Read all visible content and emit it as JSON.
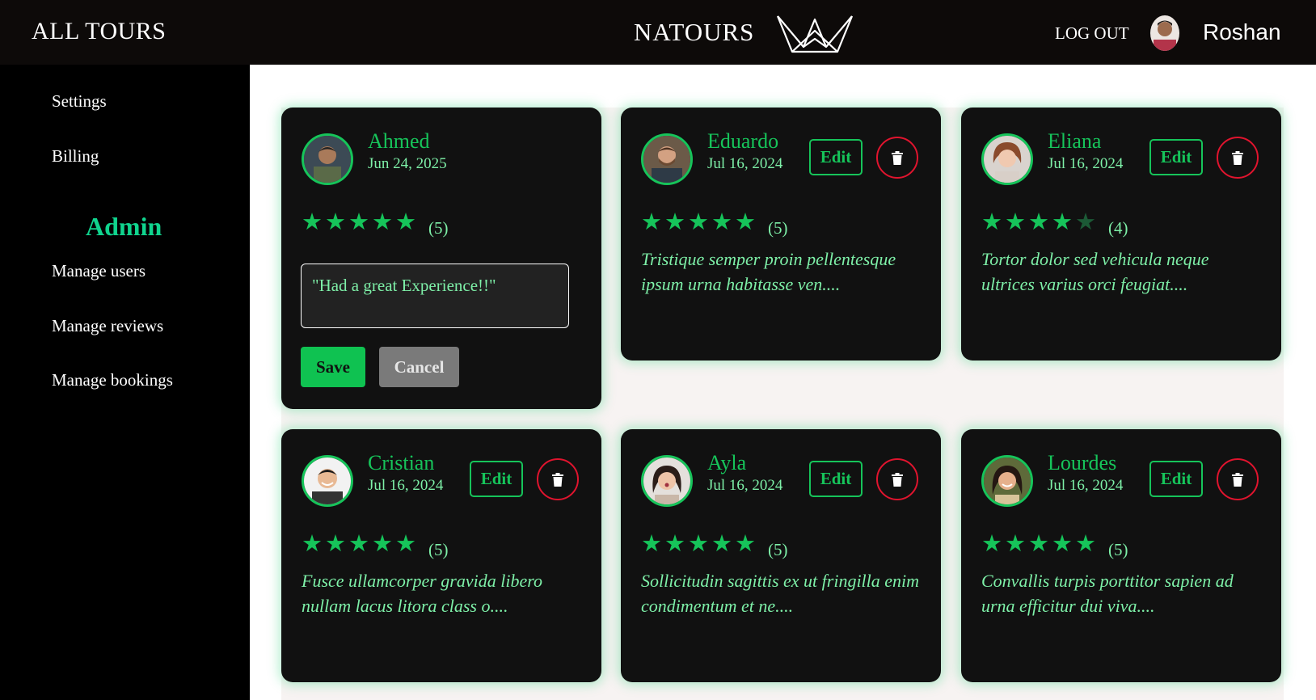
{
  "header": {
    "nav_all_tours": "ALL TOURS",
    "brand": "NATOURS",
    "logout": "LOG OUT",
    "user_name": "Roshan"
  },
  "sidebar": {
    "items_top": [
      "Settings",
      "Billing"
    ],
    "admin_heading": "Admin",
    "admin_items": [
      "Manage users",
      "Manage reviews",
      "Manage bookings"
    ]
  },
  "actions": {
    "edit_label": "Edit",
    "save_label": "Save",
    "cancel_label": "Cancel"
  },
  "colors": {
    "accent_green": "#16c45a",
    "light_green": "#7ef0a8",
    "admin_heading": "#10d48e",
    "delete_red": "#e0142e",
    "card_bg": "#111111"
  },
  "reviews": [
    {
      "name": "Ahmed",
      "date": "Jun 24, 2025",
      "rating": 5,
      "count_label": "(5)",
      "editing": true,
      "edit_value": "\"Had a great Experience!!\""
    },
    {
      "name": "Eduardo",
      "date": "Jul 16, 2024",
      "rating": 5,
      "count_label": "(5)",
      "text": "Tristique semper proin pellentesque ipsum urna habitasse ven...."
    },
    {
      "name": "Eliana",
      "date": "Jul 16, 2024",
      "rating": 4,
      "count_label": "(4)",
      "text": "Tortor dolor sed vehicula neque ultrices varius orci feugiat...."
    },
    {
      "name": "Cristian",
      "date": "Jul 16, 2024",
      "rating": 5,
      "count_label": "(5)",
      "text": "Fusce ullamcorper gravida libero nullam lacus litora class o...."
    },
    {
      "name": "Ayla",
      "date": "Jul 16, 2024",
      "rating": 5,
      "count_label": "(5)",
      "text": "Sollicitudin sagittis ex ut fringilla enim condimentum et ne...."
    },
    {
      "name": "Lourdes",
      "date": "Jul 16, 2024",
      "rating": 5,
      "count_label": "(5)",
      "text": "Convallis turpis porttitor sapien ad urna efficitur dui viva...."
    }
  ]
}
